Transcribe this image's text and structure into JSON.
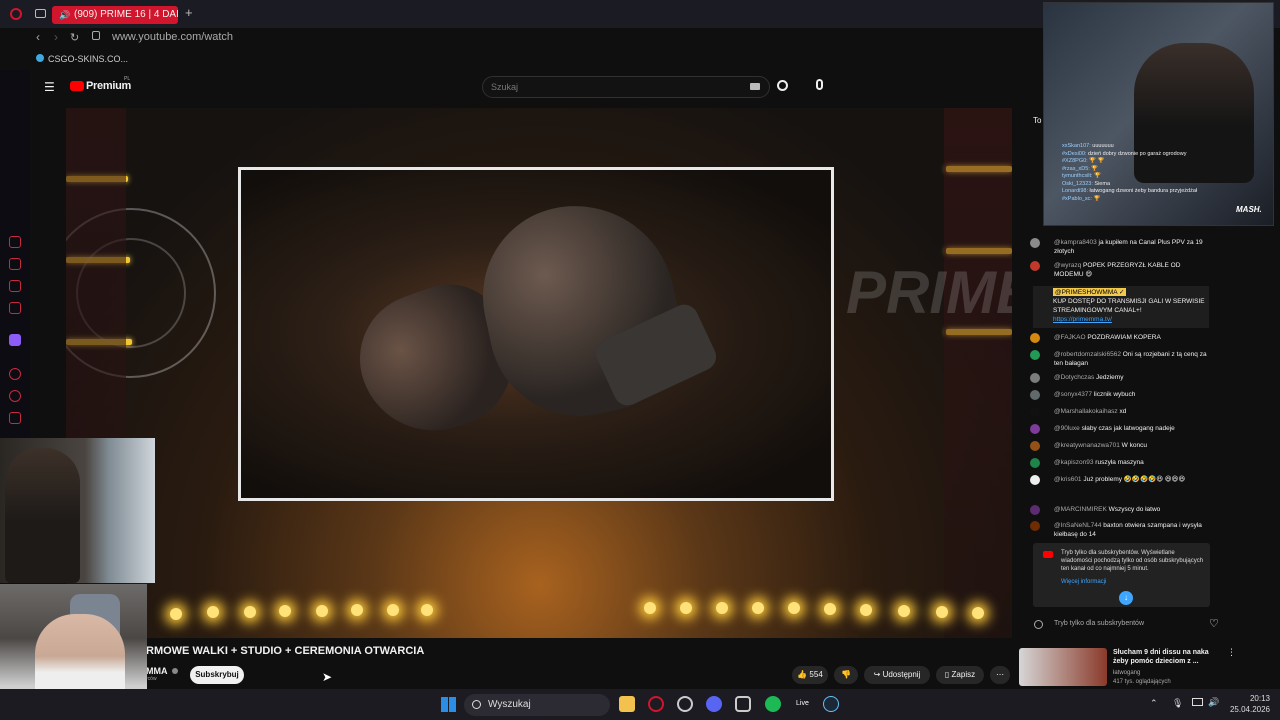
{
  "browser": {
    "tab_label": "(909) PRIME 16 | 4 DAI",
    "url": "www.youtube.com/watch",
    "bookmark": "CSGO-SKINS.CO..."
  },
  "youtube": {
    "logo_label": "Premium",
    "logo_suffix": "PL",
    "search_placeholder": "Szukaj"
  },
  "video": {
    "title": "RMOWE WALKI + STUDIO + CEREMONIA OTWARCIA",
    "channel": "MMA",
    "channel_sub": "rców",
    "subscribe_label": "Subskrybuj",
    "likes": "554",
    "share_label": "Udostępnij",
    "save_label": "Zapisz",
    "overlay_brand": "PRIME"
  },
  "chat": {
    "header": "To",
    "messages": [
      {
        "author": "@kampra8403",
        "text": "ja kupiłem na Canal Plus PPV za 19 złotych",
        "color": "#8a8a8a"
      },
      {
        "author": "@wyrazq",
        "text": "POPEK PRZEGRYZŁ KABLE OD MODEMU 😄",
        "color": "#c0392b"
      },
      {
        "author": "@FAJKAO",
        "text": "POZDRAWIAM KOPERA",
        "color": "#d68910"
      },
      {
        "author": "@robertdomzalski6562",
        "text": "Oni są rozjebani z tą cenq za ten bałagan",
        "color": "#229954"
      },
      {
        "author": "@Dotychczas",
        "text": "Jedziemy",
        "color": "#7b7d7d"
      },
      {
        "author": "@sonyx4377",
        "text": "licznik wybuch",
        "color": "#616a6b"
      },
      {
        "author": "@Marshallakokaihasz",
        "text": "xd",
        "color": "#111111"
      },
      {
        "author": "@90luxe",
        "text": "słaby czas jak latwogang nadeje",
        "color": "#7d3c98"
      },
      {
        "author": "@kreatywnanazwa701",
        "text": "W koncu",
        "color": "#935116"
      },
      {
        "author": "@kapiszon93",
        "text": "ruszyła maszyna",
        "color": "#1e8449"
      },
      {
        "author": "@kris601",
        "text": "Już problemy 🤣🤣🤣🤣😆 😆😆😆",
        "color": "#eeeeee"
      },
      {
        "author": "@MARCINMIREK",
        "text": "Wszyscy do łatwo",
        "color": "#5b2c6f"
      },
      {
        "author": "@InSaNeNL744",
        "text": "baxton otwiera szampana i wysyła kiełbasę do 14",
        "color": "#6e2c00"
      }
    ],
    "pinned_author": "@PRIMESHOWMMA ✓",
    "pinned_text": "KUP DOSTĘP DO TRANSMISJI GALI W SERWISIE STREAMINGOWYM CANAL+!",
    "pinned_link": "https://primemma.tv/",
    "members_notice": "Tryb tylko dla subskrybentów. Wyświetlane wiadomości pochodzą tylko od osób subskrybujących ten kanał od co najmniej 5 minut.",
    "more_info": "Więcej informacji",
    "input_placeholder": "Tryb tylko dla subskrybentów"
  },
  "stream_chat": {
    "lines": [
      {
        "name": "xxSkan107:",
        "text": "uuuuuuu"
      },
      {
        "name": "#xDesi00:",
        "text": "dzień dobry dzwonie po garaż ogrodowy"
      },
      {
        "name": "#XZ8PG0:",
        "text": "🏆 🏆"
      },
      {
        "name": "#rzas_xD5:",
        "text": "🏆"
      },
      {
        "name": "tymunthcsilt:",
        "text": "🏆"
      },
      {
        "name": "Oski_12323:",
        "text": "Siema"
      },
      {
        "name": "Lonardi98:",
        "text": "łatwogang dzwoni żeby bandura przyjeżdżał"
      },
      {
        "name": "#xPablo_sc:",
        "text": "🏆"
      }
    ],
    "watermark": "MASH."
  },
  "suggested": {
    "title": "Słucham 9 dni dissu na naka żeby pomóc dzieciom z ...",
    "channel": "łatwogang",
    "meta": "417 tys. oglądających"
  },
  "taskbar": {
    "search_label": "Wyszukaj",
    "time": "20:13",
    "date": "25.04.2026",
    "live_label": "Live"
  },
  "colors": {
    "accent": "#d0152c",
    "led": "#f5c531",
    "youtube_red": "#ff0000"
  }
}
